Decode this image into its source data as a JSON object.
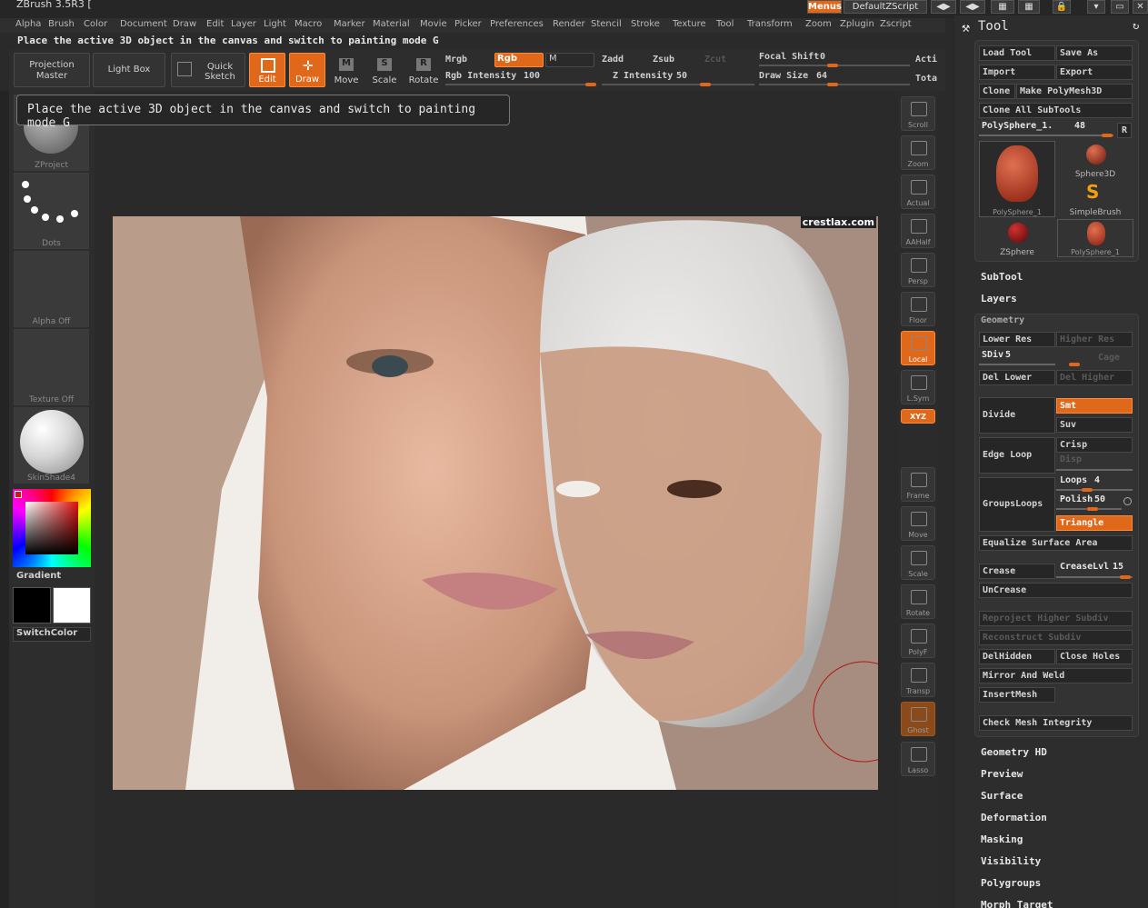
{
  "app": {
    "title": "ZBrush 3.5R3 [",
    "menus_label": "Menus",
    "script_label": "DefaultZScript"
  },
  "menu": [
    "Alpha",
    "Brush",
    "Color",
    "Document",
    "Draw",
    "Edit",
    "Layer",
    "Light",
    "Macro",
    "Marker",
    "Material",
    "Movie",
    "Picker",
    "Preferences",
    "Render",
    "Stencil",
    "Stroke",
    "Texture",
    "Tool",
    "Transform",
    "Zoom",
    "Zplugin",
    "Zscript"
  ],
  "hint": {
    "text": "Place the active 3D object in the canvas and switch to painting mode  G"
  },
  "tooltip": {
    "text": "Place the active 3D object in the canvas and switch to painting mode  G"
  },
  "topbar": {
    "projection_master": "Projection Master",
    "light_box": "Light Box",
    "quick_sketch": "Quick Sketch",
    "edit": "Edit",
    "draw": "Draw",
    "move": "Move",
    "scale": "Scale",
    "rotate": "Rotate",
    "mrgb": "Mrgb",
    "rgb": "Rgb",
    "m": "M",
    "zadd": "Zadd",
    "zsub": "Zsub",
    "zcut": "Zcut",
    "rgb_intensity_label": "Rgb Intensity",
    "rgb_intensity": "100",
    "z_intensity_label": "Z Intensity",
    "z_intensity": "50",
    "focal_shift_label": "Focal Shift",
    "focal_shift": "0",
    "draw_size_label": "Draw Size",
    "draw_size": "64",
    "acti": "Acti",
    "tota": "Tota"
  },
  "left_shelf": {
    "zproject": "ZProject",
    "dots": "Dots",
    "alpha": "Alpha Off",
    "texture": "Texture Off",
    "material": "SkinShade4",
    "gradient": "Gradient",
    "switch_color": "SwitchColor"
  },
  "right_shelf": [
    "Scroll",
    "Zoom",
    "Actual",
    "AAHalf",
    "Persp",
    "Floor",
    "Local",
    "L.Sym",
    "XYZ",
    "Frame",
    "Move",
    "Scale",
    "Rotate",
    "PolyF",
    "Transp",
    "Ghost",
    "Lasso"
  ],
  "canvas": {
    "watermark": "crestlax.com"
  },
  "tool_panel": {
    "title": "Tool",
    "load_tool": "Load Tool",
    "save_as": "Save As",
    "import": "Import",
    "export": "Export",
    "clone": "Clone",
    "make_polymesh": "Make PolyMesh3D",
    "clone_all": "Clone All SubTools",
    "poly_label": "PolySphere_1.",
    "poly_value": "48",
    "r": "R",
    "thumbs": [
      "PolySphere_1",
      "Sphere3D",
      "SimpleBrush",
      "ZSphere",
      "PolySphere_1"
    ],
    "subtool": "SubTool",
    "layers": "Layers",
    "geometry": "Geometry",
    "lower_res": "Lower Res",
    "higher_res": "Higher Res",
    "sdiv_label": "SDiv",
    "sdiv": "5",
    "cage": "Cage",
    "del_lower": "Del Lower",
    "del_higher": "Del Higher",
    "divide": "Divide",
    "smt": "Smt",
    "suv": "Suv",
    "edge_loop": "Edge Loop",
    "crisp": "Crisp",
    "disp": "Disp",
    "groups_loops": "GroupsLoops",
    "loops_label": "Loops",
    "loops": "4",
    "polish_label": "Polish",
    "polish": "50",
    "triangle": "Triangle",
    "equalize": "Equalize Surface Area",
    "crease": "Crease",
    "crease_lvl_label": "CreaseLvl",
    "crease_lvl": "15",
    "uncrease": "UnCrease",
    "reproject": "Reproject Higher Subdiv",
    "reconstruct": "Reconstruct Subdiv",
    "del_hidden": "DelHidden",
    "close_holes": "Close Holes",
    "mirror_weld": "Mirror And Weld",
    "insert_mesh": "InsertMesh",
    "check_mesh": "Check Mesh Integrity",
    "sections": [
      "Geometry HD",
      "Preview",
      "Surface",
      "Deformation",
      "Masking",
      "Visibility",
      "Polygroups",
      "Morph Target"
    ]
  }
}
